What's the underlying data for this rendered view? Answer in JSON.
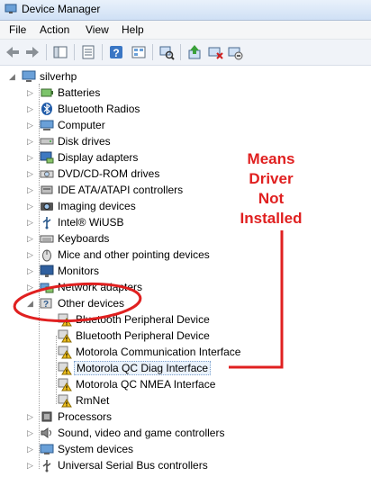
{
  "window": {
    "title": "Device Manager"
  },
  "menu": [
    "File",
    "Action",
    "View",
    "Help"
  ],
  "toolbar": [
    "back-icon",
    "forward-icon",
    "properties-icon",
    "help-icon",
    "view-icon",
    "properties2-icon",
    "scan-icon",
    "update-driver-icon",
    "uninstall-icon",
    "enable-icon"
  ],
  "tree": {
    "root": "silverhp",
    "categories": [
      {
        "label": "Batteries",
        "icon": "battery-icon"
      },
      {
        "label": "Bluetooth Radios",
        "icon": "bluetooth-icon"
      },
      {
        "label": "Computer",
        "icon": "computer-icon"
      },
      {
        "label": "Disk drives",
        "icon": "disk-icon"
      },
      {
        "label": "Display adapters",
        "icon": "display-icon"
      },
      {
        "label": "DVD/CD-ROM drives",
        "icon": "dvd-icon"
      },
      {
        "label": "IDE ATA/ATAPI controllers",
        "icon": "ide-icon"
      },
      {
        "label": "Imaging devices",
        "icon": "camera-icon"
      },
      {
        "label": "Intel® WiUSB",
        "icon": "wiusb-icon"
      },
      {
        "label": "Keyboards",
        "icon": "keyboard-icon"
      },
      {
        "label": "Mice and other pointing devices",
        "icon": "mouse-icon"
      },
      {
        "label": "Monitors",
        "icon": "monitor-icon"
      },
      {
        "label": "Network adapters",
        "icon": "network-icon"
      },
      {
        "label": "Other devices",
        "icon": "unknown-device-icon"
      }
    ],
    "other_devices": [
      {
        "label": "Bluetooth Peripheral Device"
      },
      {
        "label": "Bluetooth Peripheral Device"
      },
      {
        "label": "Motorola Communication Interface"
      },
      {
        "label": "Motorola QC Diag Interface"
      },
      {
        "label": "Motorola QC NMEA Interface"
      },
      {
        "label": "RmNet"
      }
    ],
    "after": [
      {
        "label": "Processors",
        "icon": "processor-icon"
      },
      {
        "label": "Sound, video and game controllers",
        "icon": "sound-icon"
      },
      {
        "label": "System devices",
        "icon": "system-icon"
      },
      {
        "label": "Universal Serial Bus controllers",
        "icon": "usb-icon"
      }
    ]
  },
  "annotation": {
    "lines": [
      "Means",
      "Driver",
      "Not",
      "Installed"
    ],
    "color": "#e02020"
  }
}
